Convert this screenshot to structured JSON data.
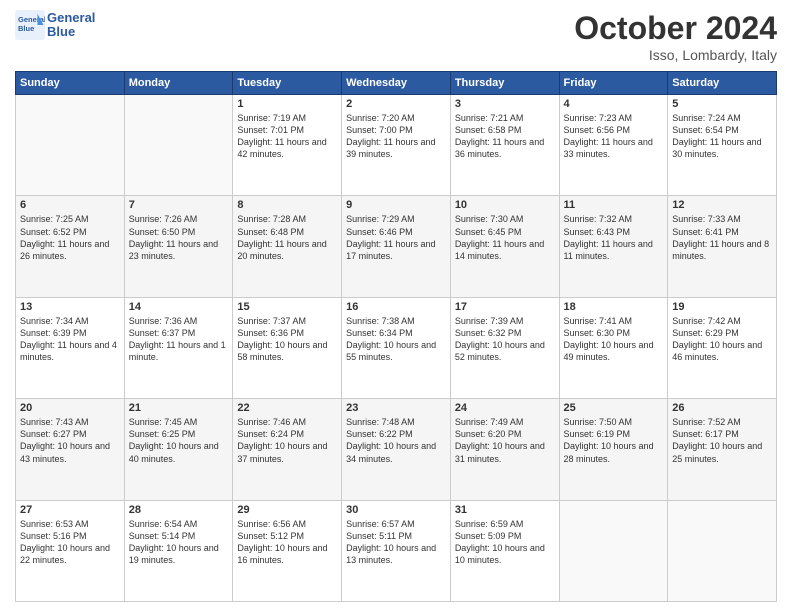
{
  "header": {
    "logo_line1": "General",
    "logo_line2": "Blue",
    "title": "October 2024",
    "location": "Isso, Lombardy, Italy"
  },
  "days_of_week": [
    "Sunday",
    "Monday",
    "Tuesday",
    "Wednesday",
    "Thursday",
    "Friday",
    "Saturday"
  ],
  "weeks": [
    [
      {
        "day": null
      },
      {
        "day": null
      },
      {
        "day": "1",
        "sunrise": "7:19 AM",
        "sunset": "7:01 PM",
        "daylight": "11 hours and 42 minutes."
      },
      {
        "day": "2",
        "sunrise": "7:20 AM",
        "sunset": "7:00 PM",
        "daylight": "11 hours and 39 minutes."
      },
      {
        "day": "3",
        "sunrise": "7:21 AM",
        "sunset": "6:58 PM",
        "daylight": "11 hours and 36 minutes."
      },
      {
        "day": "4",
        "sunrise": "7:23 AM",
        "sunset": "6:56 PM",
        "daylight": "11 hours and 33 minutes."
      },
      {
        "day": "5",
        "sunrise": "7:24 AM",
        "sunset": "6:54 PM",
        "daylight": "11 hours and 30 minutes."
      }
    ],
    [
      {
        "day": "6",
        "sunrise": "7:25 AM",
        "sunset": "6:52 PM",
        "daylight": "11 hours and 26 minutes."
      },
      {
        "day": "7",
        "sunrise": "7:26 AM",
        "sunset": "6:50 PM",
        "daylight": "11 hours and 23 minutes."
      },
      {
        "day": "8",
        "sunrise": "7:28 AM",
        "sunset": "6:48 PM",
        "daylight": "11 hours and 20 minutes."
      },
      {
        "day": "9",
        "sunrise": "7:29 AM",
        "sunset": "6:46 PM",
        "daylight": "11 hours and 17 minutes."
      },
      {
        "day": "10",
        "sunrise": "7:30 AM",
        "sunset": "6:45 PM",
        "daylight": "11 hours and 14 minutes."
      },
      {
        "day": "11",
        "sunrise": "7:32 AM",
        "sunset": "6:43 PM",
        "daylight": "11 hours and 11 minutes."
      },
      {
        "day": "12",
        "sunrise": "7:33 AM",
        "sunset": "6:41 PM",
        "daylight": "11 hours and 8 minutes."
      }
    ],
    [
      {
        "day": "13",
        "sunrise": "7:34 AM",
        "sunset": "6:39 PM",
        "daylight": "11 hours and 4 minutes."
      },
      {
        "day": "14",
        "sunrise": "7:36 AM",
        "sunset": "6:37 PM",
        "daylight": "11 hours and 1 minute."
      },
      {
        "day": "15",
        "sunrise": "7:37 AM",
        "sunset": "6:36 PM",
        "daylight": "10 hours and 58 minutes."
      },
      {
        "day": "16",
        "sunrise": "7:38 AM",
        "sunset": "6:34 PM",
        "daylight": "10 hours and 55 minutes."
      },
      {
        "day": "17",
        "sunrise": "7:39 AM",
        "sunset": "6:32 PM",
        "daylight": "10 hours and 52 minutes."
      },
      {
        "day": "18",
        "sunrise": "7:41 AM",
        "sunset": "6:30 PM",
        "daylight": "10 hours and 49 minutes."
      },
      {
        "day": "19",
        "sunrise": "7:42 AM",
        "sunset": "6:29 PM",
        "daylight": "10 hours and 46 minutes."
      }
    ],
    [
      {
        "day": "20",
        "sunrise": "7:43 AM",
        "sunset": "6:27 PM",
        "daylight": "10 hours and 43 minutes."
      },
      {
        "day": "21",
        "sunrise": "7:45 AM",
        "sunset": "6:25 PM",
        "daylight": "10 hours and 40 minutes."
      },
      {
        "day": "22",
        "sunrise": "7:46 AM",
        "sunset": "6:24 PM",
        "daylight": "10 hours and 37 minutes."
      },
      {
        "day": "23",
        "sunrise": "7:48 AM",
        "sunset": "6:22 PM",
        "daylight": "10 hours and 34 minutes."
      },
      {
        "day": "24",
        "sunrise": "7:49 AM",
        "sunset": "6:20 PM",
        "daylight": "10 hours and 31 minutes."
      },
      {
        "day": "25",
        "sunrise": "7:50 AM",
        "sunset": "6:19 PM",
        "daylight": "10 hours and 28 minutes."
      },
      {
        "day": "26",
        "sunrise": "7:52 AM",
        "sunset": "6:17 PM",
        "daylight": "10 hours and 25 minutes."
      }
    ],
    [
      {
        "day": "27",
        "sunrise": "6:53 AM",
        "sunset": "5:16 PM",
        "daylight": "10 hours and 22 minutes."
      },
      {
        "day": "28",
        "sunrise": "6:54 AM",
        "sunset": "5:14 PM",
        "daylight": "10 hours and 19 minutes."
      },
      {
        "day": "29",
        "sunrise": "6:56 AM",
        "sunset": "5:12 PM",
        "daylight": "10 hours and 16 minutes."
      },
      {
        "day": "30",
        "sunrise": "6:57 AM",
        "sunset": "5:11 PM",
        "daylight": "10 hours and 13 minutes."
      },
      {
        "day": "31",
        "sunrise": "6:59 AM",
        "sunset": "5:09 PM",
        "daylight": "10 hours and 10 minutes."
      },
      {
        "day": null
      },
      {
        "day": null
      }
    ]
  ]
}
